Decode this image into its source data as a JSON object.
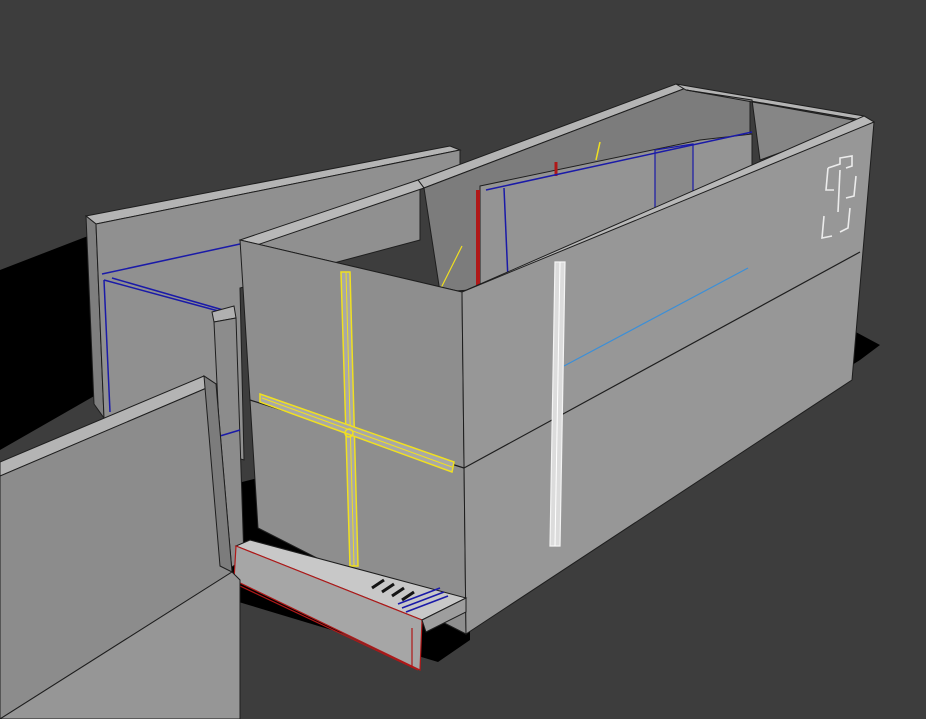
{
  "viewport": {
    "background_color": "#3d3d3d",
    "shadow_color": "#000000",
    "wall_colors": {
      "top_face": "#b4b4b4",
      "front_face": "#8a8a8a",
      "side_face": "#979797",
      "inner_face": "#7e7e7e",
      "edge": "#1e1e1e"
    },
    "highlight_colors": {
      "yellow_selection": "#f0e020",
      "blue_edge": "#1a1aa8",
      "red_edge": "#b01818",
      "light_blue_line": "#3b8fd8",
      "white_pole": "#e6e6e6"
    },
    "objects": [
      {
        "name": "back-left-wall",
        "icon": "wall-mesh"
      },
      {
        "name": "main-box-room",
        "icon": "box-mesh"
      },
      {
        "name": "cross-window-frame",
        "icon": "cross-mesh"
      },
      {
        "name": "white-pole",
        "icon": "cylinder-mesh"
      },
      {
        "name": "entrance-steps",
        "icon": "stairs-mesh"
      },
      {
        "name": "wall-cross-emblem",
        "icon": "cross-mesh"
      },
      {
        "name": "front-left-wall",
        "icon": "wall-mesh"
      }
    ]
  }
}
